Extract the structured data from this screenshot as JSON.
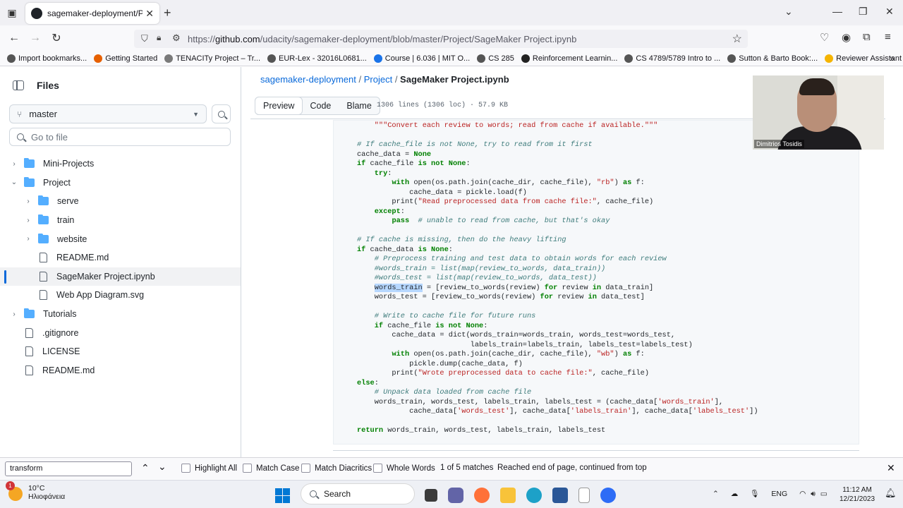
{
  "browser": {
    "tab_title": "sagemaker-deployment/Project/SageMaker Project.ipynb at master · udacity/sagemaker-deployment",
    "url_prefix": "https://",
    "url_host": "github.com",
    "url_path": "/udacity/sagemaker-deployment/blob/master/Project/SageMaker Project.ipynb"
  },
  "bookmarks": [
    {
      "label": "Import bookmarks...",
      "color": "#555555"
    },
    {
      "label": "Getting Started",
      "color": "#e66000"
    },
    {
      "label": "TENACITy Project – Tr...",
      "color": "#7a7a7a"
    },
    {
      "label": "EUR-Lex - 32016L0681...",
      "color": "#555555"
    },
    {
      "label": "Course | 6.036 | MIT O...",
      "color": "#1a73e8"
    },
    {
      "label": "CS 285",
      "color": "#555555"
    },
    {
      "label": "Reinforcement Learnin...",
      "color": "#222222"
    },
    {
      "label": "CS 4789/5789 Intro to ...",
      "color": "#555555"
    },
    {
      "label": "Sutton & Barto Book:...",
      "color": "#555555"
    },
    {
      "label": "Reviewer Assistant To...",
      "color": "#f5b400"
    }
  ],
  "sidebar": {
    "title": "Files",
    "branch": "master",
    "goto_placeholder": "Go to file",
    "tree": [
      {
        "label": "Mini-Projects",
        "type": "folder",
        "depth": 0,
        "chev": "›"
      },
      {
        "label": "Project",
        "type": "folder",
        "depth": 0,
        "chev": "⌄"
      },
      {
        "label": "serve",
        "type": "folder",
        "depth": 1,
        "chev": "›"
      },
      {
        "label": "train",
        "type": "folder",
        "depth": 1,
        "chev": "›"
      },
      {
        "label": "website",
        "type": "folder",
        "depth": 1,
        "chev": "›"
      },
      {
        "label": "README.md",
        "type": "file",
        "depth": 1,
        "chev": ""
      },
      {
        "label": "SageMaker Project.ipynb",
        "type": "file",
        "depth": 1,
        "chev": "",
        "selected": true
      },
      {
        "label": "Web App Diagram.svg",
        "type": "file",
        "depth": 1,
        "chev": ""
      },
      {
        "label": "Tutorials",
        "type": "folder",
        "depth": 0,
        "chev": "›"
      },
      {
        "label": ".gitignore",
        "type": "file",
        "depth": 0,
        "chev": ""
      },
      {
        "label": "LICENSE",
        "type": "file",
        "depth": 0,
        "chev": ""
      },
      {
        "label": "README.md",
        "type": "file",
        "depth": 0,
        "chev": ""
      }
    ]
  },
  "breadcrumb": {
    "repo": "sagemaker-deployment",
    "folder": "Project",
    "file": "SageMaker Project.ipynb"
  },
  "viewer": {
    "tabs": [
      "Preview",
      "Code",
      "Blame"
    ],
    "meta": "1306 lines (1306 loc) · 57.9 KB"
  },
  "webcam": {
    "name": "Dimitrios Tosidis"
  },
  "find": {
    "query": "transform",
    "options": [
      "Highlight All",
      "Match Case",
      "Match Diacritics",
      "Whole Words"
    ],
    "count": "1 of 5 matches",
    "status": "Reached end of page, continued from top"
  },
  "taskbar": {
    "temp": "10°C",
    "weather": "Ηλιοφάνεια",
    "search": "Search",
    "lang": "ENG",
    "time": "11:12 AM",
    "date": "12/21/2023",
    "badge": "1"
  },
  "code_lines": [
    [
      [
        "c",
        ""
      ],
      [
        "t",
        "    "
      ],
      [
        "s",
        "\"\"\"Convert each review to words; read from cache if available.\"\"\""
      ]
    ],
    [
      [
        "t",
        ""
      ]
    ],
    [
      [
        "c",
        "# If cache_file is not None, try to read from it first"
      ]
    ],
    [
      [
        "t",
        "cache_data = "
      ],
      [
        "k",
        "None"
      ]
    ],
    [
      [
        "k",
        "if"
      ],
      [
        "t",
        " cache_file "
      ],
      [
        "k",
        "is not None"
      ],
      [
        "t",
        ":"
      ]
    ],
    [
      [
        "t",
        "    "
      ],
      [
        "k",
        "try"
      ],
      [
        "t",
        ":"
      ]
    ],
    [
      [
        "t",
        "        "
      ],
      [
        "k",
        "with"
      ],
      [
        "t",
        " open(os.path.join(cache_dir, cache_file), "
      ],
      [
        "s",
        "\"rb\""
      ],
      [
        "t",
        ") "
      ],
      [
        "k",
        "as"
      ],
      [
        "t",
        " f:"
      ]
    ],
    [
      [
        "t",
        "            cache_data = pickle.load(f)"
      ]
    ],
    [
      [
        "t",
        "        print("
      ],
      [
        "s",
        "\"Read preprocessed data from cache file:\""
      ],
      [
        "t",
        ", cache_file)"
      ]
    ],
    [
      [
        "t",
        "    "
      ],
      [
        "k",
        "except"
      ],
      [
        "t",
        ":"
      ]
    ],
    [
      [
        "t",
        "        "
      ],
      [
        "k",
        "pass"
      ],
      [
        "t",
        "  "
      ],
      [
        "c",
        "# unable to read from cache, but that's okay"
      ]
    ],
    [
      [
        "t",
        ""
      ]
    ],
    [
      [
        "c",
        "# If cache is missing, then do the heavy lifting"
      ]
    ],
    [
      [
        "k",
        "if"
      ],
      [
        "t",
        " cache_data "
      ],
      [
        "k",
        "is None"
      ],
      [
        "t",
        ":"
      ]
    ],
    [
      [
        "t",
        "    "
      ],
      [
        "c",
        "# Preprocess training and test data to obtain words for each review"
      ]
    ],
    [
      [
        "t",
        "    "
      ],
      [
        "c",
        "#words_train = list(map(review_to_words, data_train))"
      ]
    ],
    [
      [
        "t",
        "    "
      ],
      [
        "c",
        "#words_test = list(map(review_to_words, data_test))"
      ]
    ],
    [
      [
        "t",
        "    "
      ],
      [
        "h",
        "words_train"
      ],
      [
        "t",
        " = [review_to_words(review) "
      ],
      [
        "k",
        "for"
      ],
      [
        "t",
        " review "
      ],
      [
        "k",
        "in"
      ],
      [
        "t",
        " data_train]"
      ]
    ],
    [
      [
        "t",
        "    words_test = [review_to_words(review) "
      ],
      [
        "k",
        "for"
      ],
      [
        "t",
        " review "
      ],
      [
        "k",
        "in"
      ],
      [
        "t",
        " data_test]"
      ]
    ],
    [
      [
        "t",
        ""
      ]
    ],
    [
      [
        "t",
        "    "
      ],
      [
        "c",
        "# Write to cache file for future runs"
      ]
    ],
    [
      [
        "t",
        "    "
      ],
      [
        "k",
        "if"
      ],
      [
        "t",
        " cache_file "
      ],
      [
        "k",
        "is not None"
      ],
      [
        "t",
        ":"
      ]
    ],
    [
      [
        "t",
        "        cache_data = dict(words_train=words_train, words_test=words_test,"
      ]
    ],
    [
      [
        "t",
        "                          labels_train=labels_train, labels_test=labels_test)"
      ]
    ],
    [
      [
        "t",
        "        "
      ],
      [
        "k",
        "with"
      ],
      [
        "t",
        " open(os.path.join(cache_dir, cache_file), "
      ],
      [
        "s",
        "\"wb\""
      ],
      [
        "t",
        ") "
      ],
      [
        "k",
        "as"
      ],
      [
        "t",
        " f:"
      ]
    ],
    [
      [
        "t",
        "            pickle.dump(cache_data, f)"
      ]
    ],
    [
      [
        "t",
        "        print("
      ],
      [
        "s",
        "\"Wrote preprocessed data to cache file:\""
      ],
      [
        "t",
        ", cache_file)"
      ]
    ],
    [
      [
        "k",
        "else"
      ],
      [
        "t",
        ":"
      ]
    ],
    [
      [
        "t",
        "    "
      ],
      [
        "c",
        "# Unpack data loaded from cache file"
      ]
    ],
    [
      [
        "t",
        "    words_train, words_test, labels_train, labels_test = (cache_data["
      ],
      [
        "s",
        "'words_train'"
      ],
      [
        "t",
        "],"
      ]
    ],
    [
      [
        "t",
        "            cache_data["
      ],
      [
        "s",
        "'words_test'"
      ],
      [
        "t",
        "], cache_data["
      ],
      [
        "s",
        "'labels_train'"
      ],
      [
        "t",
        "], cache_data["
      ],
      [
        "s",
        "'labels_test'"
      ],
      [
        "t",
        "])"
      ]
    ],
    [
      [
        "t",
        ""
      ]
    ],
    [
      [
        "k",
        "return"
      ],
      [
        "t",
        " words_train, words_test, labels_train, labels_test"
      ]
    ]
  ]
}
